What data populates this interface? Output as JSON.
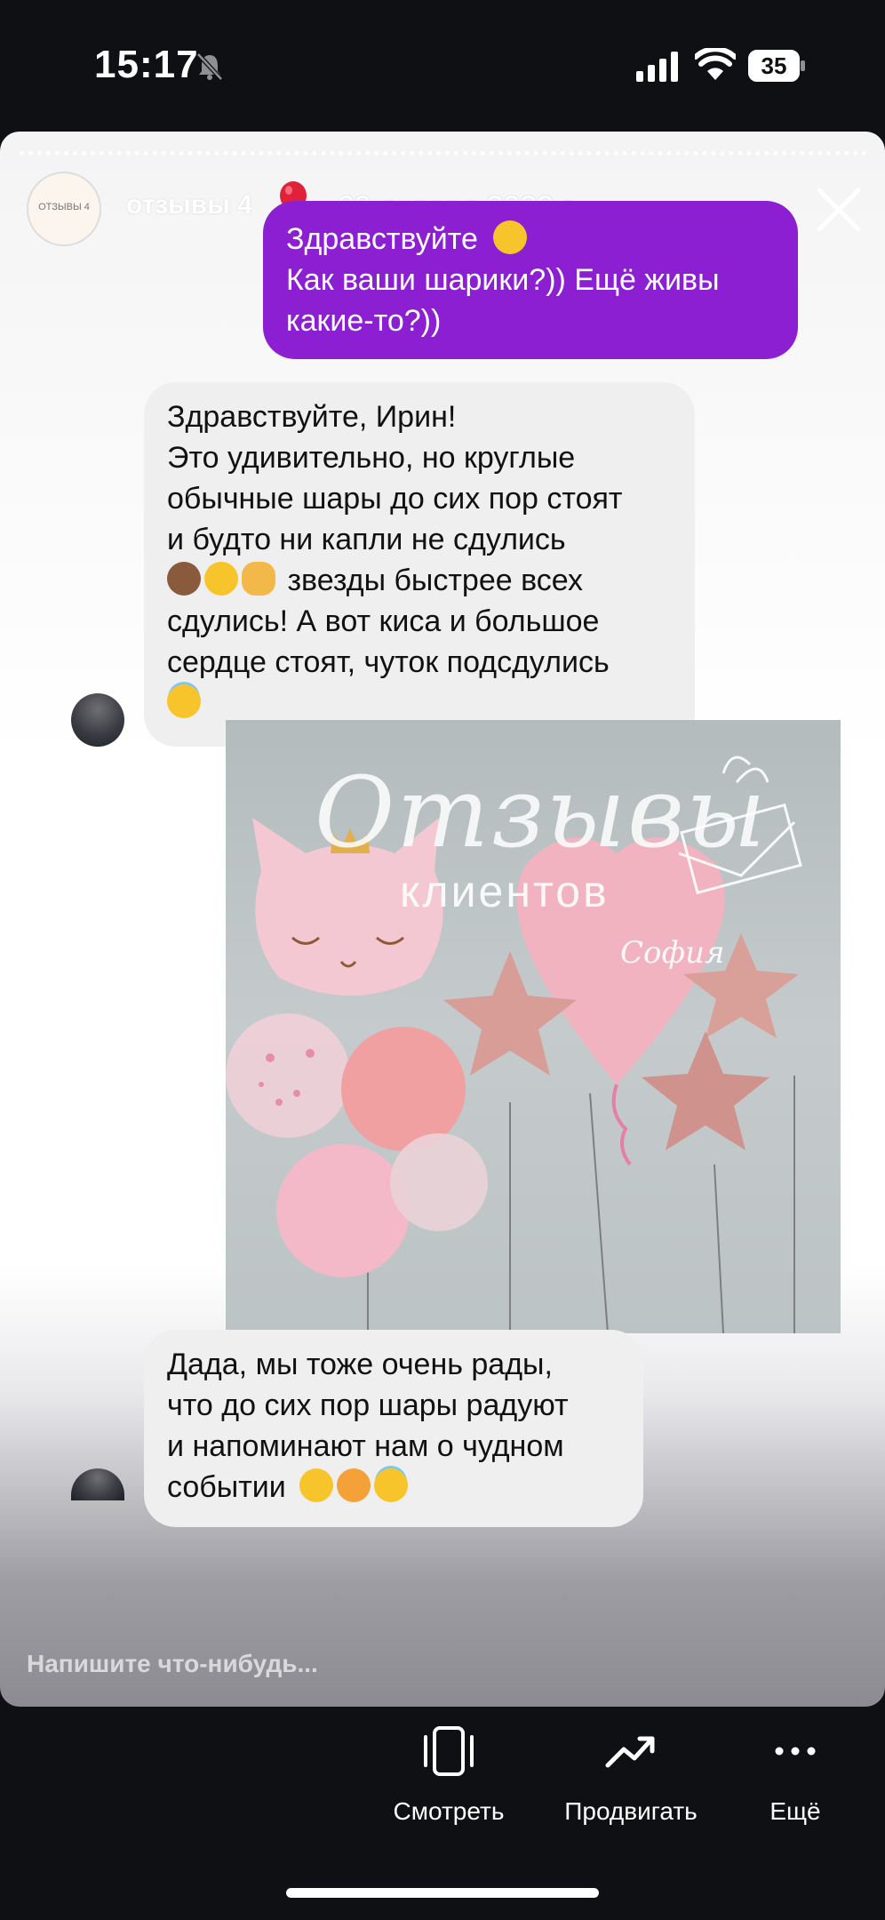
{
  "status_bar": {
    "time": "15:17",
    "battery_level": "35",
    "icons": [
      "bell-muted-icon",
      "signal-icon",
      "wifi-icon",
      "battery-icon"
    ]
  },
  "story": {
    "account_name": "отзывы 4",
    "avatar_caption": "ОТЗЫВЫ 4",
    "date": "29 января 2022 г.",
    "close_icon": "close-icon",
    "messages": {
      "sent": {
        "lines": [
          "Здравствуйте",
          "Как ваши шарики?)) Ещё живы",
          "какие-то?))"
        ]
      },
      "received_1": {
        "lines": [
          "Здравствуйте, Ирин!",
          "Это удивительно, но круглые",
          "обычные шары до сих пор стоят",
          "и будто ни капли не сдулись",
          "звезды быстрее всех",
          "сдулись! А вот киса и большое",
          "сердце стоят, чуток подсдулись"
        ]
      },
      "photo": {
        "title": "Отзывы",
        "subtitle": "клиентов",
        "name_on_balloon": "София"
      },
      "received_2": {
        "lines": [
          "Дада, мы тоже очень рады,",
          "что до сих пор шары радуют",
          "и напоминают нам о чудном",
          "событии"
        ]
      }
    },
    "input_placeholder": "Напишите что-нибудь...",
    "colors": {
      "sent_bubble": "#8b1fd1",
      "received_bubble": "#efeff0"
    }
  },
  "bottom_bar": {
    "actions": [
      {
        "label": "Смотреть",
        "icon": "phone-view-icon"
      },
      {
        "label": "Продвигать",
        "icon": "trending-up-icon"
      },
      {
        "label": "Ещё",
        "icon": "more-dots-icon"
      }
    ]
  }
}
